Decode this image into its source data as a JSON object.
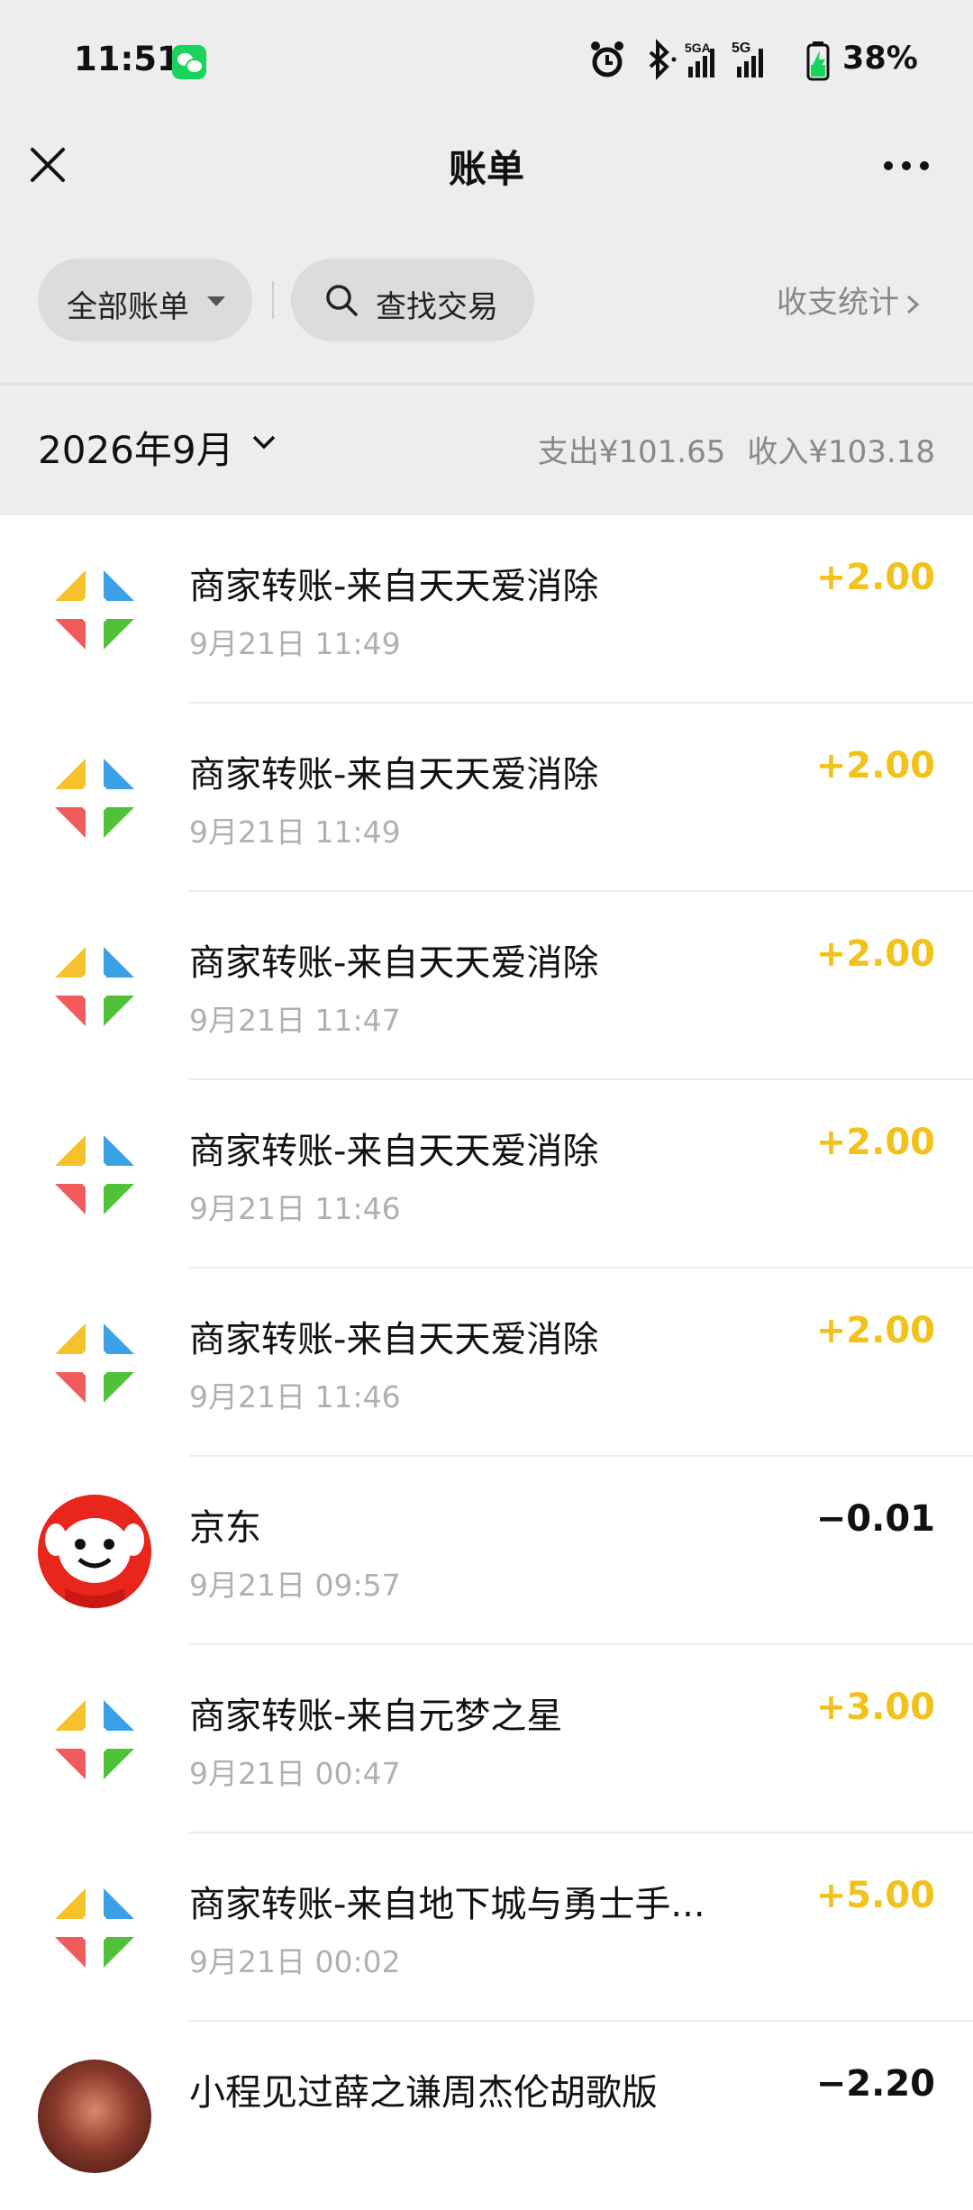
{
  "status_bar": {
    "time": "11:51",
    "battery": "38%",
    "icons": [
      "wechat-icon",
      "alarm-icon",
      "bluetooth-icon",
      "signal-5ga-icon",
      "signal-5g-icon",
      "battery-icon"
    ]
  },
  "header": {
    "title": "账单",
    "close_icon": "close-icon",
    "more_icon": "more-icon"
  },
  "filters": {
    "all_bills": "全部账单",
    "search": "查找交易",
    "stats": "收支统计"
  },
  "month_bar": {
    "month": "2026年9月",
    "expense": "支出¥101.65",
    "income": "收入¥103.18"
  },
  "transactions": [
    {
      "title": "商家转账-来自天天爱消除",
      "time": "9月21日 11:49",
      "amount": "+2.00",
      "type": "income",
      "icon": "merchant-transfer-icon"
    },
    {
      "title": "商家转账-来自天天爱消除",
      "time": "9月21日 11:49",
      "amount": "+2.00",
      "type": "income",
      "icon": "merchant-transfer-icon"
    },
    {
      "title": "商家转账-来自天天爱消除",
      "time": "9月21日 11:47",
      "amount": "+2.00",
      "type": "income",
      "icon": "merchant-transfer-icon"
    },
    {
      "title": "商家转账-来自天天爱消除",
      "time": "9月21日 11:46",
      "amount": "+2.00",
      "type": "income",
      "icon": "merchant-transfer-icon"
    },
    {
      "title": "商家转账-来自天天爱消除",
      "time": "9月21日 11:46",
      "amount": "+2.00",
      "type": "income",
      "icon": "merchant-transfer-icon"
    },
    {
      "title": "京东",
      "time": "9月21日 09:57",
      "amount": "−0.01",
      "type": "expense",
      "icon": "jd-logo-icon"
    },
    {
      "title": "商家转账-来自元梦之星",
      "time": "9月21日 00:47",
      "amount": "+3.00",
      "type": "income",
      "icon": "merchant-transfer-icon"
    },
    {
      "title": "商家转账-来自地下城与勇士手...",
      "time": "9月21日 00:02",
      "amount": "+5.00",
      "type": "income",
      "icon": "merchant-transfer-icon"
    },
    {
      "title": "小程见过薛之谦周杰伦胡歌版",
      "time": "",
      "amount": "−2.20",
      "type": "expense",
      "icon": "mini-program-avatar-icon"
    }
  ],
  "colors": {
    "income": "#f2c21b",
    "expense": "#111111",
    "header_bg": "#ededed"
  }
}
